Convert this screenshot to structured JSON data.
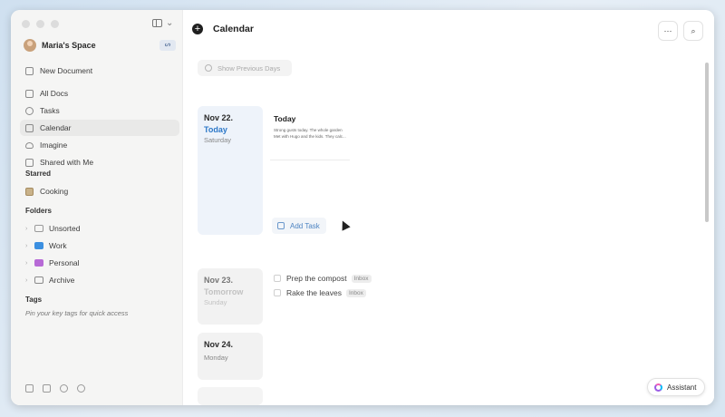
{
  "sidebar": {
    "space_name": "Maria's Space",
    "space_badge": "ᔕ",
    "nav": [
      {
        "label": "New Document"
      },
      {
        "label": "All Docs"
      },
      {
        "label": "Tasks"
      },
      {
        "label": "Calendar"
      },
      {
        "label": "Imagine"
      },
      {
        "label": "Shared with Me"
      }
    ],
    "starred_label": "Starred",
    "starred": [
      {
        "label": "Cooking"
      }
    ],
    "folders_label": "Folders",
    "folders": [
      {
        "label": "Unsorted",
        "color": "#9a9a9a"
      },
      {
        "label": "Work",
        "color": "#3b8fe0"
      },
      {
        "label": "Personal",
        "color": "#b76ad6"
      },
      {
        "label": "Archive",
        "color": "#8a8a8a"
      }
    ],
    "tags_label": "Tags",
    "tags_hint": "Pin your key tags for quick access"
  },
  "main": {
    "title": "Calendar",
    "show_previous": "Show Previous Days",
    "days": [
      {
        "date": "Nov 22.",
        "relative": "Today",
        "weekday": "Saturday"
      },
      {
        "date": "Nov 23.",
        "relative": "Tomorrow",
        "weekday": "Sunday"
      },
      {
        "date": "Nov 24.",
        "weekday": "Monday"
      }
    ],
    "doc_preview": {
      "title": "Today",
      "line1": "Strong gusts today. The whole garden",
      "line2": "Met with Hugo and the kids. They calc..."
    },
    "add_task": "Add Task",
    "tasks": [
      {
        "label": "Prep the compost",
        "tag": "Inbox"
      },
      {
        "label": "Rake the leaves",
        "tag": "Inbox"
      }
    ],
    "assistant": "Assistant",
    "accent": "#2d78c8"
  }
}
